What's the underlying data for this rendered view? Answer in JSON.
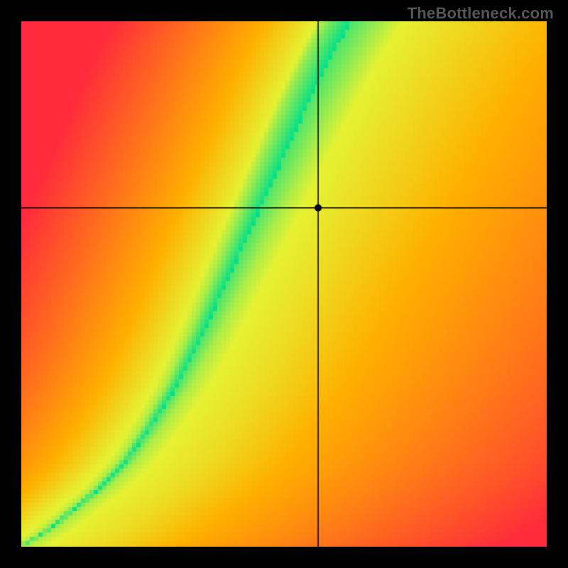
{
  "watermark": "TheBottleneck.com",
  "chart_data": {
    "type": "heatmap",
    "title": "",
    "xlabel": "",
    "ylabel": "",
    "xlim": [
      0,
      1
    ],
    "ylim": [
      0,
      1
    ],
    "grid": false,
    "legend": false,
    "marker": {
      "x": 0.565,
      "y": 0.645,
      "radius": 5
    },
    "crosshair": {
      "x": 0.565,
      "y": 0.645
    },
    "optimal_curve": {
      "description": "Approximate centerline of the green optimal band, as (x, y) fractions of the plot area from bottom-left origin.",
      "points": [
        [
          0.0,
          0.0
        ],
        [
          0.05,
          0.03
        ],
        [
          0.1,
          0.07
        ],
        [
          0.15,
          0.11
        ],
        [
          0.2,
          0.16
        ],
        [
          0.25,
          0.23
        ],
        [
          0.3,
          0.31
        ],
        [
          0.35,
          0.41
        ],
        [
          0.4,
          0.52
        ],
        [
          0.45,
          0.63
        ],
        [
          0.5,
          0.74
        ],
        [
          0.55,
          0.85
        ],
        [
          0.6,
          0.95
        ],
        [
          0.63,
          1.0
        ]
      ]
    },
    "band_halfwidth_top": 0.06,
    "band_halfwidth_bottom": 0.008,
    "colors": {
      "best": "#00e08a",
      "good": "#e6f233",
      "warm": "#ffb000",
      "bad": "#ff2a3c"
    },
    "pixelation": 6,
    "plot_size": 740,
    "plot_offset": {
      "x": 30,
      "y": 30
    },
    "stage_size": 800
  }
}
